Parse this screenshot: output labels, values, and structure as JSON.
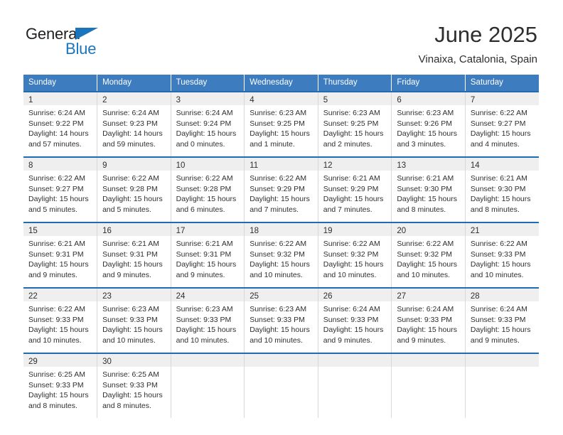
{
  "logo": {
    "text_primary": "General",
    "text_secondary": "Blue",
    "triangle_icon": "blue-triangle-icon",
    "primary_color": "#231f20",
    "secondary_color": "#1b75bc"
  },
  "header": {
    "title": "June 2025",
    "subtitle": "Vinaixa, Catalonia, Spain"
  },
  "colors": {
    "header_bg": "#3c7cbf",
    "row_divider": "#1f6cb0",
    "daynum_band": "#efefef",
    "text": "#2f2f2f"
  },
  "weekday_headers": [
    "Sunday",
    "Monday",
    "Tuesday",
    "Wednesday",
    "Thursday",
    "Friday",
    "Saturday"
  ],
  "weeks": [
    [
      {
        "day": "1",
        "sunrise": "Sunrise: 6:24 AM",
        "sunset": "Sunset: 9:22 PM",
        "daylight1": "Daylight: 14 hours",
        "daylight2": "and 57 minutes."
      },
      {
        "day": "2",
        "sunrise": "Sunrise: 6:24 AM",
        "sunset": "Sunset: 9:23 PM",
        "daylight1": "Daylight: 14 hours",
        "daylight2": "and 59 minutes."
      },
      {
        "day": "3",
        "sunrise": "Sunrise: 6:24 AM",
        "sunset": "Sunset: 9:24 PM",
        "daylight1": "Daylight: 15 hours",
        "daylight2": "and 0 minutes."
      },
      {
        "day": "4",
        "sunrise": "Sunrise: 6:23 AM",
        "sunset": "Sunset: 9:25 PM",
        "daylight1": "Daylight: 15 hours",
        "daylight2": "and 1 minute."
      },
      {
        "day": "5",
        "sunrise": "Sunrise: 6:23 AM",
        "sunset": "Sunset: 9:25 PM",
        "daylight1": "Daylight: 15 hours",
        "daylight2": "and 2 minutes."
      },
      {
        "day": "6",
        "sunrise": "Sunrise: 6:23 AM",
        "sunset": "Sunset: 9:26 PM",
        "daylight1": "Daylight: 15 hours",
        "daylight2": "and 3 minutes."
      },
      {
        "day": "7",
        "sunrise": "Sunrise: 6:22 AM",
        "sunset": "Sunset: 9:27 PM",
        "daylight1": "Daylight: 15 hours",
        "daylight2": "and 4 minutes."
      }
    ],
    [
      {
        "day": "8",
        "sunrise": "Sunrise: 6:22 AM",
        "sunset": "Sunset: 9:27 PM",
        "daylight1": "Daylight: 15 hours",
        "daylight2": "and 5 minutes."
      },
      {
        "day": "9",
        "sunrise": "Sunrise: 6:22 AM",
        "sunset": "Sunset: 9:28 PM",
        "daylight1": "Daylight: 15 hours",
        "daylight2": "and 5 minutes."
      },
      {
        "day": "10",
        "sunrise": "Sunrise: 6:22 AM",
        "sunset": "Sunset: 9:28 PM",
        "daylight1": "Daylight: 15 hours",
        "daylight2": "and 6 minutes."
      },
      {
        "day": "11",
        "sunrise": "Sunrise: 6:22 AM",
        "sunset": "Sunset: 9:29 PM",
        "daylight1": "Daylight: 15 hours",
        "daylight2": "and 7 minutes."
      },
      {
        "day": "12",
        "sunrise": "Sunrise: 6:21 AM",
        "sunset": "Sunset: 9:29 PM",
        "daylight1": "Daylight: 15 hours",
        "daylight2": "and 7 minutes."
      },
      {
        "day": "13",
        "sunrise": "Sunrise: 6:21 AM",
        "sunset": "Sunset: 9:30 PM",
        "daylight1": "Daylight: 15 hours",
        "daylight2": "and 8 minutes."
      },
      {
        "day": "14",
        "sunrise": "Sunrise: 6:21 AM",
        "sunset": "Sunset: 9:30 PM",
        "daylight1": "Daylight: 15 hours",
        "daylight2": "and 8 minutes."
      }
    ],
    [
      {
        "day": "15",
        "sunrise": "Sunrise: 6:21 AM",
        "sunset": "Sunset: 9:31 PM",
        "daylight1": "Daylight: 15 hours",
        "daylight2": "and 9 minutes."
      },
      {
        "day": "16",
        "sunrise": "Sunrise: 6:21 AM",
        "sunset": "Sunset: 9:31 PM",
        "daylight1": "Daylight: 15 hours",
        "daylight2": "and 9 minutes."
      },
      {
        "day": "17",
        "sunrise": "Sunrise: 6:21 AM",
        "sunset": "Sunset: 9:31 PM",
        "daylight1": "Daylight: 15 hours",
        "daylight2": "and 9 minutes."
      },
      {
        "day": "18",
        "sunrise": "Sunrise: 6:22 AM",
        "sunset": "Sunset: 9:32 PM",
        "daylight1": "Daylight: 15 hours",
        "daylight2": "and 10 minutes."
      },
      {
        "day": "19",
        "sunrise": "Sunrise: 6:22 AM",
        "sunset": "Sunset: 9:32 PM",
        "daylight1": "Daylight: 15 hours",
        "daylight2": "and 10 minutes."
      },
      {
        "day": "20",
        "sunrise": "Sunrise: 6:22 AM",
        "sunset": "Sunset: 9:32 PM",
        "daylight1": "Daylight: 15 hours",
        "daylight2": "and 10 minutes."
      },
      {
        "day": "21",
        "sunrise": "Sunrise: 6:22 AM",
        "sunset": "Sunset: 9:33 PM",
        "daylight1": "Daylight: 15 hours",
        "daylight2": "and 10 minutes."
      }
    ],
    [
      {
        "day": "22",
        "sunrise": "Sunrise: 6:22 AM",
        "sunset": "Sunset: 9:33 PM",
        "daylight1": "Daylight: 15 hours",
        "daylight2": "and 10 minutes."
      },
      {
        "day": "23",
        "sunrise": "Sunrise: 6:23 AM",
        "sunset": "Sunset: 9:33 PM",
        "daylight1": "Daylight: 15 hours",
        "daylight2": "and 10 minutes."
      },
      {
        "day": "24",
        "sunrise": "Sunrise: 6:23 AM",
        "sunset": "Sunset: 9:33 PM",
        "daylight1": "Daylight: 15 hours",
        "daylight2": "and 10 minutes."
      },
      {
        "day": "25",
        "sunrise": "Sunrise: 6:23 AM",
        "sunset": "Sunset: 9:33 PM",
        "daylight1": "Daylight: 15 hours",
        "daylight2": "and 10 minutes."
      },
      {
        "day": "26",
        "sunrise": "Sunrise: 6:24 AM",
        "sunset": "Sunset: 9:33 PM",
        "daylight1": "Daylight: 15 hours",
        "daylight2": "and 9 minutes."
      },
      {
        "day": "27",
        "sunrise": "Sunrise: 6:24 AM",
        "sunset": "Sunset: 9:33 PM",
        "daylight1": "Daylight: 15 hours",
        "daylight2": "and 9 minutes."
      },
      {
        "day": "28",
        "sunrise": "Sunrise: 6:24 AM",
        "sunset": "Sunset: 9:33 PM",
        "daylight1": "Daylight: 15 hours",
        "daylight2": "and 9 minutes."
      }
    ],
    [
      {
        "day": "29",
        "sunrise": "Sunrise: 6:25 AM",
        "sunset": "Sunset: 9:33 PM",
        "daylight1": "Daylight: 15 hours",
        "daylight2": "and 8 minutes."
      },
      {
        "day": "30",
        "sunrise": "Sunrise: 6:25 AM",
        "sunset": "Sunset: 9:33 PM",
        "daylight1": "Daylight: 15 hours",
        "daylight2": "and 8 minutes."
      },
      {
        "day": "",
        "sunrise": "",
        "sunset": "",
        "daylight1": "",
        "daylight2": ""
      },
      {
        "day": "",
        "sunrise": "",
        "sunset": "",
        "daylight1": "",
        "daylight2": ""
      },
      {
        "day": "",
        "sunrise": "",
        "sunset": "",
        "daylight1": "",
        "daylight2": ""
      },
      {
        "day": "",
        "sunrise": "",
        "sunset": "",
        "daylight1": "",
        "daylight2": ""
      },
      {
        "day": "",
        "sunrise": "",
        "sunset": "",
        "daylight1": "",
        "daylight2": ""
      }
    ]
  ]
}
